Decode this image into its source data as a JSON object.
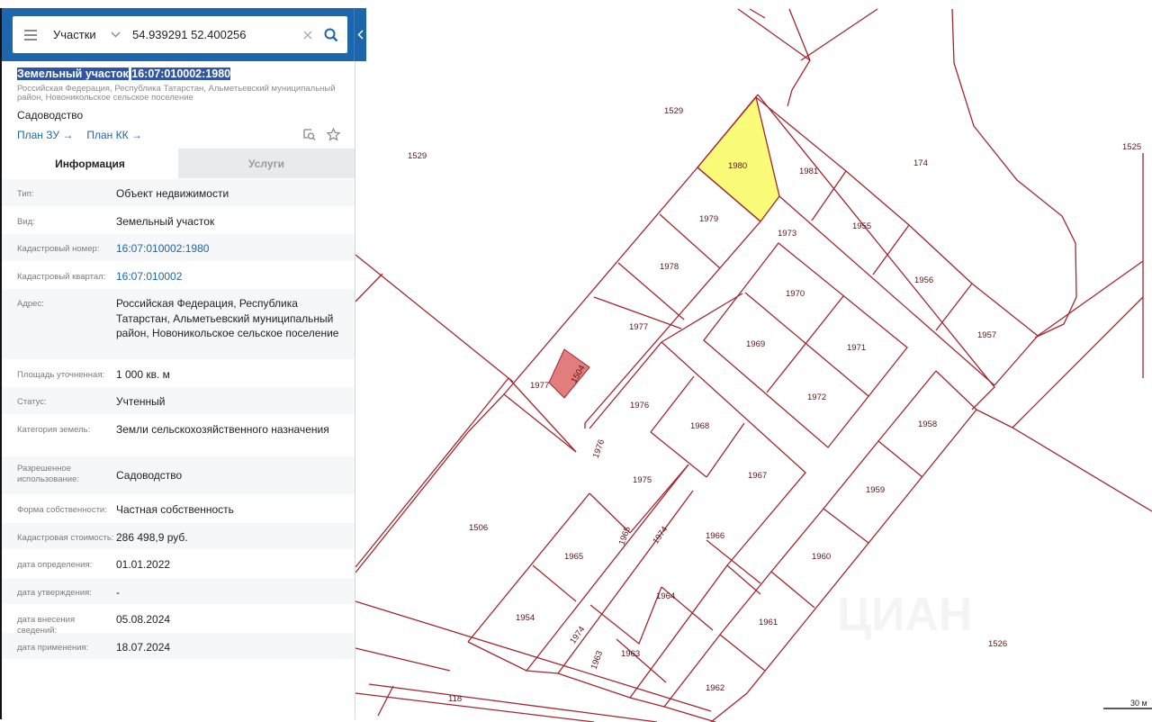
{
  "search": {
    "type_label": "Участки",
    "query": "54.939291 52.400256"
  },
  "object": {
    "title_prefix": "Земельный участок",
    "cadastral_number": "16:07:010002:1980",
    "address_short": "Российская Федерация, Республика Татарстан, Альметьевский муниципальный район, Новоникольское сельское поселение",
    "use": "Садоводство",
    "links": [
      "План ЗУ →",
      "План КК →"
    ]
  },
  "tabs": [
    "Информация",
    "Услуги"
  ],
  "properties": [
    {
      "key": "Тип:",
      "value": "Объект недвижимости"
    },
    {
      "key": "Вид:",
      "value": "Земельный участок"
    },
    {
      "key": "Кадастровый номер:",
      "value": "16:07:010002:1980"
    },
    {
      "key": "Кадастровый квартал:",
      "value": "16:07:010002"
    },
    {
      "key": "Адрес:",
      "value": "Российская Федерация, Республика Татарстан, Альметьевский муниципальный район, Новоникольское сельское поселение"
    },
    {
      "key": "Площадь уточненная:",
      "value": "1 000 кв. м"
    },
    {
      "key": "Статус:",
      "value": "Учтенный"
    },
    {
      "key": "Категория земель:",
      "value": "Земли сельскохозяйственного назначения"
    },
    {
      "key": "Разрешенное использование:",
      "value": "Садоводство"
    },
    {
      "key": "Форма собственности:",
      "value": "Частная собственность"
    },
    {
      "key": "Кадастровая стоимость:",
      "value": "286 498,9 руб."
    },
    {
      "key": "дата определения:",
      "value": "01.01.2022"
    },
    {
      "key": "дата утверждения:",
      "value": "-"
    },
    {
      "key": "дата внесения сведений:",
      "value": "05.08.2024"
    },
    {
      "key": "дата применения:",
      "value": "18.07.2024"
    }
  ],
  "map": {
    "labels": [
      "1529",
      "1529",
      "1980",
      "1981",
      "174",
      "1525",
      "1979",
      "1973",
      "1955",
      "1978",
      "1970",
      "1956",
      "1977",
      "1969",
      "1971",
      "1957",
      "1504",
      "1977",
      "1976",
      "1972",
      "1968",
      "1958",
      "1976",
      "1967",
      "1975",
      "1959",
      "1506",
      "1965",
      "1965",
      "1974",
      "1966",
      "1960",
      "1964",
      "1954",
      "1974",
      "1961",
      "1963",
      "1963",
      "1526",
      "1962",
      "118"
    ],
    "scale_label": "30 м",
    "watermark": "ЦИАН",
    "colors": {
      "selected": "#fbfb7a",
      "other": "#e27d7d",
      "border": "#a2262e"
    }
  }
}
